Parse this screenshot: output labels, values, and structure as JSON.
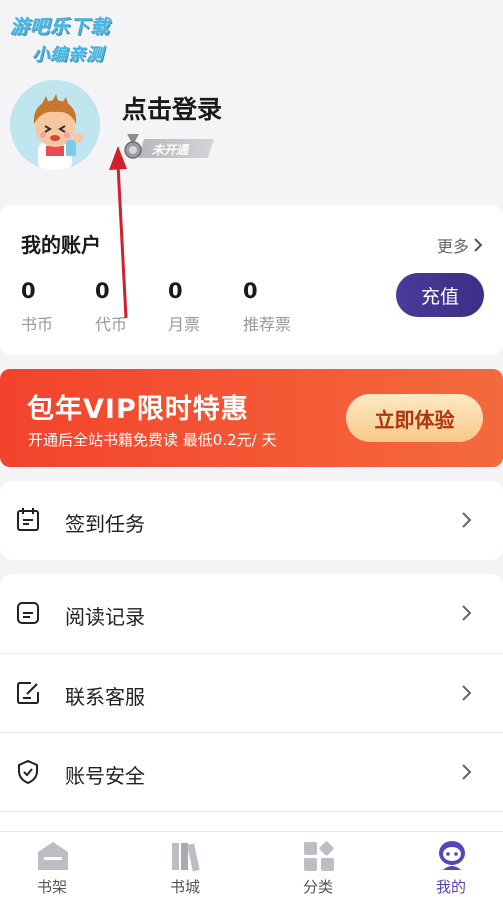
{
  "watermark": {
    "line1": "游吧乐下载",
    "line2": "小编亲测"
  },
  "profile": {
    "login_text": "点击登录",
    "badge_text": "未开通",
    "avatar_icon": "cartoon-boy-avatar"
  },
  "account": {
    "title": "我的账户",
    "more_label": "更多",
    "stats": [
      {
        "value": "0",
        "label": "书币"
      },
      {
        "value": "0",
        "label": "代币"
      },
      {
        "value": "0",
        "label": "月票"
      },
      {
        "value": "0",
        "label": "推荐票"
      }
    ],
    "recharge_label": "充值"
  },
  "vip_banner": {
    "title": "包年VIP限时特惠",
    "subtitle": "开通后全站书籍免费读 最低0.2元/ 天",
    "button_label": "立即体验"
  },
  "menu": [
    {
      "label": "签到任务",
      "icon": "calendar-icon"
    },
    {
      "label": "阅读记录",
      "icon": "document-icon"
    },
    {
      "label": "联系客服",
      "icon": "edit-icon"
    },
    {
      "label": "账号安全",
      "icon": "shield-icon"
    }
  ],
  "tabs": [
    {
      "label": "书架",
      "icon": "bookshelf-icon"
    },
    {
      "label": "书城",
      "icon": "books-icon"
    },
    {
      "label": "分类",
      "icon": "category-icon"
    },
    {
      "label": "我的",
      "icon": "profile-icon",
      "active": true
    }
  ],
  "colors": {
    "accent": "#5b44b4",
    "recharge_bg": "#3c2f85",
    "vip_bg": "#f2432c",
    "annotation_arrow": "#d0202c"
  }
}
